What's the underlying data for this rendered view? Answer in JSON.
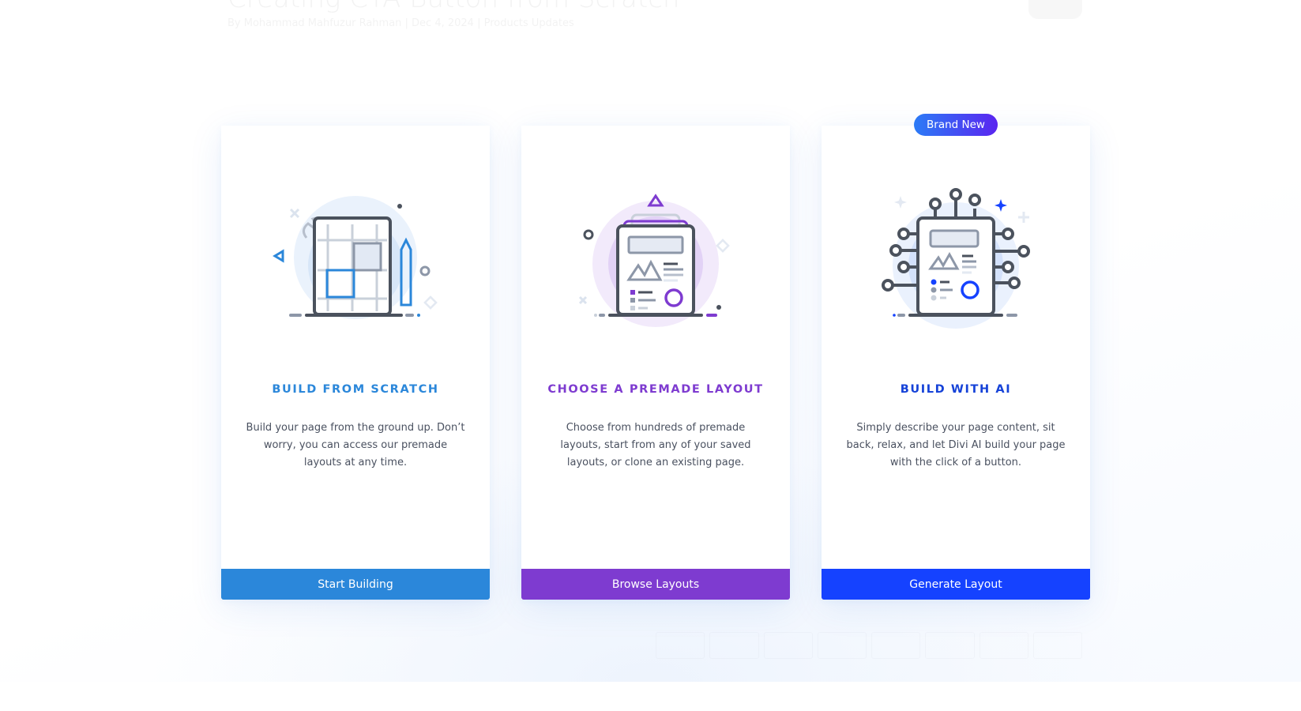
{
  "background_article": {
    "title": "Creating CTA Button from Scratch",
    "meta": "By Mohammad Mahfuzur Rahman | Dec 4, 2024 | Products Updates"
  },
  "colors": {
    "scratch": "#2b87da",
    "premade": "#7e3bd0",
    "ai": "#1542ff",
    "badge_start": "#2b7bf6",
    "badge_end": "#5a25f0",
    "text": "#4a5160"
  },
  "cards": [
    {
      "id": "scratch",
      "icon": "blueprint-grid-icon",
      "title": "BUILD FROM SCRATCH",
      "description": "Build your page from the ground up. Don’t worry, you can access our premade layouts at any time.",
      "button_label": "Start Building"
    },
    {
      "id": "premade",
      "icon": "layout-document-icon",
      "title": "CHOOSE A PREMADE LAYOUT",
      "description": "Choose from hundreds of premade layouts, start from any of your saved layouts, or clone an existing page.",
      "button_label": "Browse Layouts"
    },
    {
      "id": "ai",
      "icon": "ai-circuit-document-icon",
      "badge": "Brand New",
      "title": "BUILD WITH AI",
      "description": "Simply describe your page content, sit back, relax, and let Divi AI build your page with the click of a button.",
      "button_label": "Generate Layout"
    }
  ]
}
